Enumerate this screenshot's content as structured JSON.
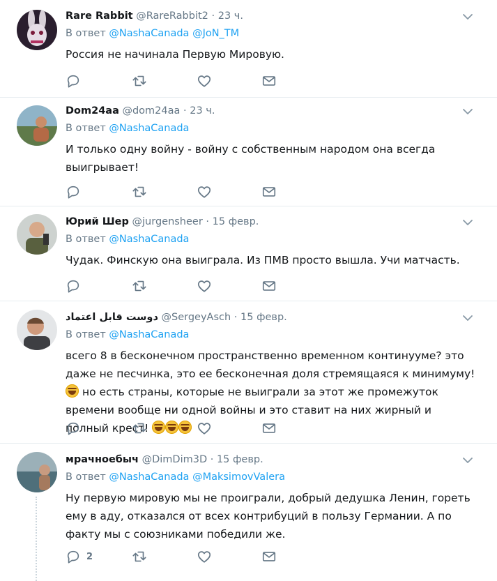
{
  "colors": {
    "link": "#1da1f2",
    "secondary": "#657786",
    "border": "#e6ecf0",
    "text": "#14171a"
  },
  "icons": {
    "reply": "reply-icon",
    "retweet": "retweet-icon",
    "like": "heart-icon",
    "dm": "envelope-icon",
    "more": "chevron-down-icon",
    "emoji": "rolling-on-floor-laughing-emoji"
  },
  "reply_prefix": "В ответ",
  "tweets": [
    {
      "name": "Rare Rabbit",
      "handle": "@RareRabbit2",
      "sep": "·",
      "time": "23 ч.",
      "mentions": [
        "@NashaCanada",
        "@JoN_TM"
      ],
      "text": "Россия не начинала Первую Мировую.",
      "reply_count": ""
    },
    {
      "name": "Dom24aa",
      "handle": "@dom24aa",
      "sep": "·",
      "time": "23 ч.",
      "mentions": [
        "@NashaCanada"
      ],
      "text": "И только одну войну - войну с собственным народом она всегда выигрывает!",
      "reply_count": ""
    },
    {
      "name": "Юрий Шер",
      "handle": "@jurgensheer",
      "sep": "·",
      "time": "15 февр.",
      "mentions": [
        "@NashaCanada"
      ],
      "text": "Чудак. Финскую она выиграла. Из ПМВ просто вышла. Учи матчасть.",
      "reply_count": ""
    },
    {
      "name": "دوست قابل اعتماد",
      "handle": "@SergeyAsch",
      "sep": "·",
      "time": "15 февр.",
      "mentions": [
        "@NashaCanada"
      ],
      "text_a": "всего 8 в бесконечном пространственно временном континууме? это даже не песчинка, это ее бесконечная доля стремящаяся к минимуму!",
      "text_b": "но есть страны, которые не выиграли за этот же промежуток времени вообще ни одной войны и это ставит на них жирный и полный крест!",
      "reply_count": ""
    },
    {
      "name": "мрачноебыч",
      "handle": "@DimDim3D",
      "sep": "·",
      "time": "15 февр.",
      "mentions": [
        "@NashaCanada",
        "@MaksimovValera"
      ],
      "text": "Ну первую мировую мы не проиграли, добрый дедушка Ленин, гореть ему в аду, отказался от всех контрибуций в пользу Германии. А по факту мы с союзниками победили же.",
      "reply_count": "2"
    }
  ]
}
